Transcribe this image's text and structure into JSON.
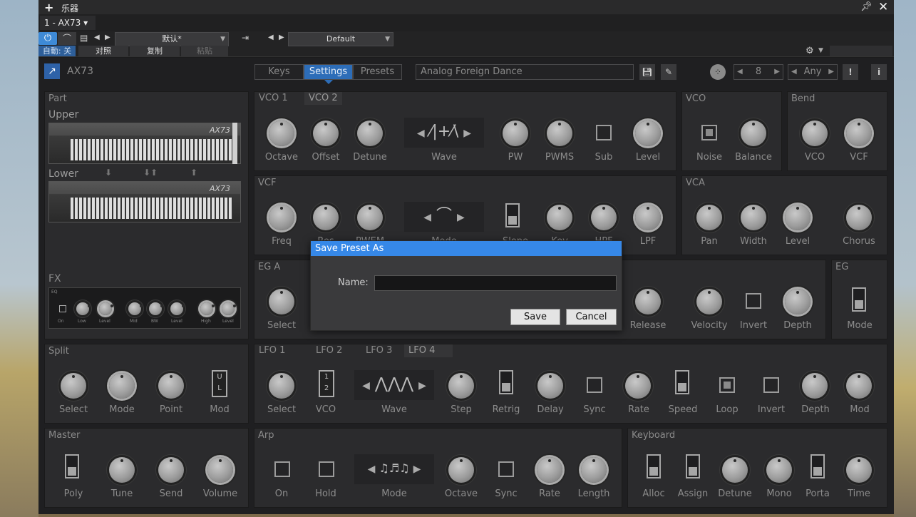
{
  "window": {
    "title": "乐器",
    "track_tab": "1 - AX73"
  },
  "toolbar": {
    "auto_label": "自動: 关",
    "compare_label": "对照",
    "copy_label": "复制",
    "paste_label": "粘贴",
    "preset_dropdown": "默认*",
    "patch_dropdown": "Default"
  },
  "plugin": {
    "name": "AX73",
    "tabs": [
      "Keys",
      "Settings",
      "Presets"
    ],
    "active_tab": "Settings",
    "preset_name": "Analog Foreign Dance",
    "voices_value": "8",
    "channel_value": "Any"
  },
  "part": {
    "title": "Part",
    "upper": "Upper",
    "lower": "Lower",
    "kbd_label": "AX73",
    "fx_title": "FX",
    "fx_labels": [
      "EQ",
      "On",
      "Low",
      "Level",
      "Mid",
      "BW",
      "Level",
      "High",
      "Level"
    ]
  },
  "vco_panel": {
    "tabs": [
      "VCO 1",
      "VCO 2"
    ],
    "labels": [
      "Octave",
      "Offset",
      "Detune",
      "Wave",
      "PW",
      "PWMS",
      "Sub",
      "Level"
    ]
  },
  "vco_mix": {
    "title": "VCO",
    "labels": [
      "Noise",
      "Balance"
    ]
  },
  "bend": {
    "title": "Bend",
    "labels": [
      "VCO",
      "VCF"
    ]
  },
  "vcf": {
    "title": "VCF",
    "labels": [
      "Freq",
      "Res",
      "PWEM",
      "Mode",
      "Slope",
      "Key",
      "HPF",
      "LPF"
    ]
  },
  "vca": {
    "title": "VCA",
    "labels": [
      "Pan",
      "Width",
      "Level",
      "Chorus"
    ]
  },
  "ega": {
    "title": "EG A",
    "labels": [
      "Select",
      "Release",
      "Velocity",
      "Invert",
      "Depth"
    ]
  },
  "eg": {
    "title": "EG",
    "labels": [
      "Mode"
    ]
  },
  "split": {
    "title": "Split",
    "labels": [
      "Select",
      "Mode",
      "Point",
      "Mod"
    ]
  },
  "lfo": {
    "tabs": [
      "LFO 1",
      "LFO 2",
      "LFO 3",
      "LFO 4"
    ],
    "labels": [
      "Select",
      "VCO",
      "Wave",
      "Step",
      "Retrig",
      "Delay",
      "Sync",
      "Rate",
      "Speed",
      "Loop",
      "Invert",
      "Depth",
      "Mod"
    ]
  },
  "master": {
    "title": "Master",
    "labels": [
      "Poly",
      "Tune",
      "Send",
      "Volume"
    ]
  },
  "arp": {
    "title": "Arp",
    "labels": [
      "On",
      "Hold",
      "Mode",
      "Octave",
      "Sync",
      "Rate",
      "Length"
    ]
  },
  "keyboard": {
    "title": "Keyboard",
    "labels": [
      "Alloc",
      "Assign",
      "Detune",
      "Mono",
      "Porta",
      "Time"
    ]
  },
  "dialog": {
    "title": "Save Preset As",
    "name_label": "Name:",
    "name_value": "",
    "save_label": "Save",
    "cancel_label": "Cancel"
  }
}
